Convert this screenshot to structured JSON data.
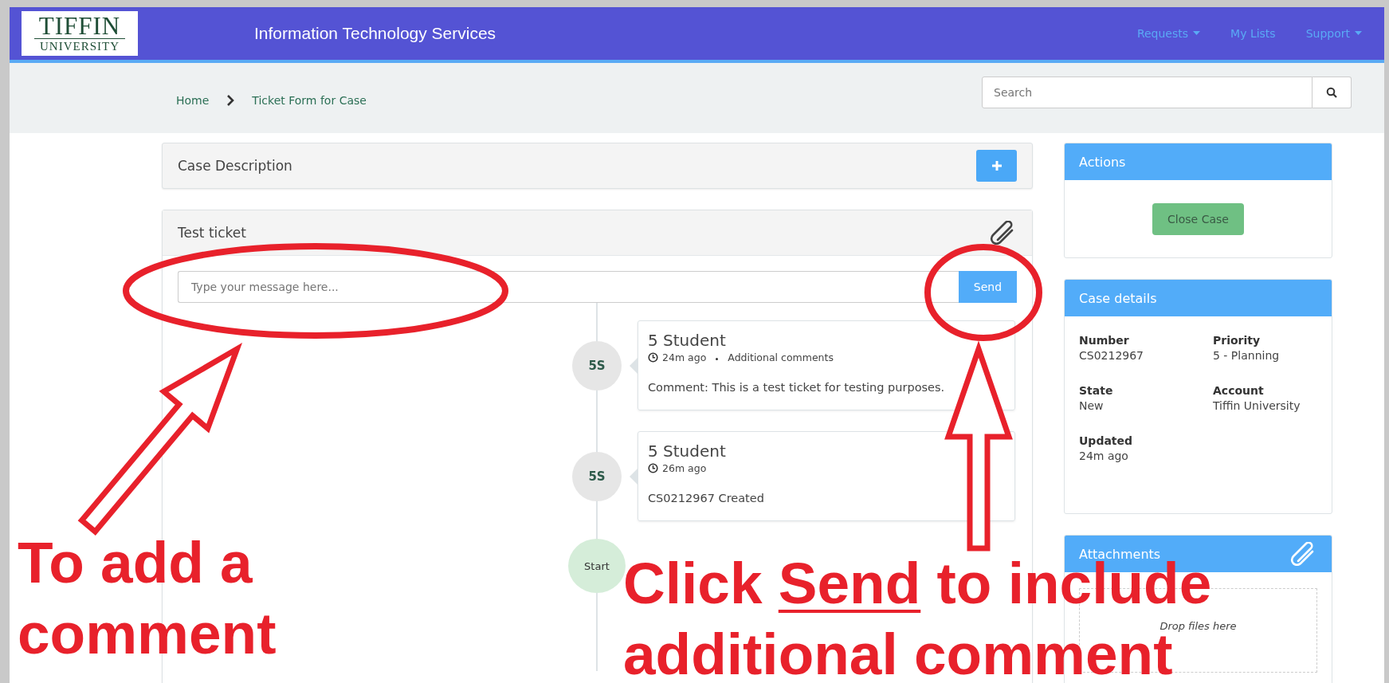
{
  "header": {
    "logo": {
      "line1": "TIFFIN",
      "line2": "UNIVERSITY"
    },
    "title": "Information Technology Services",
    "nav": [
      {
        "label": "Requests",
        "dropdown": true
      },
      {
        "label": "My Lists",
        "dropdown": false
      },
      {
        "label": "Support",
        "dropdown": true
      }
    ]
  },
  "breadcrumb": [
    {
      "label": "Home"
    },
    {
      "label": "Ticket Form for Case"
    }
  ],
  "search": {
    "placeholder": "Search"
  },
  "case_description": {
    "title": "Case Description"
  },
  "ticket": {
    "title": "Test ticket",
    "message": {
      "placeholder": "Type your message here..."
    },
    "send_button": "Send",
    "activity": [
      {
        "avatar": "5S",
        "author": "5 Student",
        "time": "24m ago",
        "type": "Additional comments",
        "body": "Comment: This is a test ticket for testing purposes."
      },
      {
        "avatar": "5S",
        "author": "5 Student",
        "time": "26m ago",
        "body": "CS0212967 Created"
      }
    ],
    "start": "Start"
  },
  "actions": {
    "title": "Actions",
    "button": "Close Case"
  },
  "case_details": {
    "title": "Case details",
    "fields": [
      {
        "label": "Number",
        "value": "CS0212967"
      },
      {
        "label": "Priority",
        "value": "5 - Planning"
      },
      {
        "label": "State",
        "value": "New"
      },
      {
        "label": "Account",
        "value": "Tiffin University"
      },
      {
        "label": "Updated",
        "value": "24m ago"
      }
    ]
  },
  "attachments": {
    "title": "Attachments",
    "drop_hint": "Drop files here"
  },
  "annotations": [
    {
      "kind": "left",
      "lines": [
        {
          "segments": [
            {
              "text": "To add a",
              "underline": false
            }
          ]
        },
        {
          "segments": [
            {
              "text": "comment",
              "underline": false
            }
          ]
        }
      ]
    },
    {
      "kind": "right",
      "lines": [
        {
          "segments": [
            {
              "text": "Click ",
              "underline": false
            },
            {
              "text": "Send",
              "underline": true
            },
            {
              "text": " to include",
              "underline": false
            }
          ]
        },
        {
          "segments": [
            {
              "text": "additional comment",
              "underline": false
            }
          ]
        }
      ]
    }
  ]
}
